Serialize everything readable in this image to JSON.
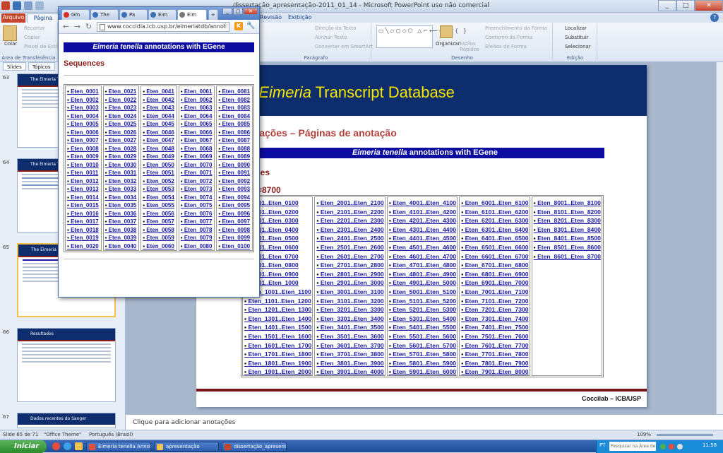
{
  "ppt": {
    "title": "dissertação_apresentação-2011_01_14  -  Microsoft PowerPoint uso não comercial",
    "tabs": {
      "file": "Arquivo",
      "home": "Página Inicial",
      "review": "Revisão",
      "view": "Exibição"
    },
    "ribbon": {
      "clipboard": {
        "paste": "Colar",
        "cut": "Recortar",
        "copy": "Copiar",
        "format_painter": "Pincel de Estilo",
        "label": "Área de Transferência"
      },
      "paragraph": {
        "text_direction": "Direção do Texto",
        "align_text": "Alinhar Texto",
        "smartart": "Converter em SmartArt",
        "label": "Parágrafo"
      },
      "drawing": {
        "arrange": "Organizar",
        "quick_styles": "Estilos Rápidos",
        "fill": "Preenchimento da Forma",
        "outline": "Contorno da Forma",
        "effects": "Efeitos de Forma",
        "label": "Desenho"
      },
      "editing": {
        "find": "Localizar",
        "replace": "Substituir",
        "select": "Selecionar",
        "label": "Edição"
      }
    },
    "panel_tabs": {
      "slides": "Slides",
      "outline": "Tópicos"
    },
    "thumbs": [
      {
        "num": "63",
        "title": "The Eimeria Transcript"
      },
      {
        "num": "64",
        "title": "The Eimeria Transcript"
      },
      {
        "num": "65",
        "title": "The Eimeria Transcript"
      },
      {
        "num": "66",
        "title": "Resultados"
      },
      {
        "num": "67",
        "title": "Dados recentes do Sanger"
      }
    ],
    "slide": {
      "title_prefix": "e ",
      "title_italic": "Eimeria",
      "title_rest": " Transcript Database",
      "subtitle": "ntações – Páginas de anotação",
      "banner_italic": "Eimeria tenella",
      "banner_rest": " annotations with EGene",
      "sequences": "ences",
      "count": "NT=8700",
      "footer": "Coccilab – ICB/USP",
      "columns": [
        [
          "_0001..Eten_0100",
          "_0101..Eten_0200",
          "_0201..Eten_0300",
          "_0301..Eten_0400",
          "_0401..Eten_0500",
          "_0501..Eten_0600",
          "_0601..Eten_0700",
          "_0701..Eten_0800",
          "_0801..Eten_0900",
          "_0901..Eten_1000",
          "Eten_1001..Eten_1100",
          "Eten_1101..Eten_1200",
          "Eten_1201..Eten_1300",
          "Eten_1301..Eten_1400",
          "Eten_1401..Eten_1500",
          "Eten_1501..Eten_1600",
          "Eten_1601..Eten_1700",
          "Eten_1701..Eten_1800",
          "Eten_1801..Eten_1900",
          "Eten_1901..Eten_2000"
        ],
        [
          "Eten_2001..Eten_2100",
          "Eten_2101..Eten_2200",
          "Eten_2201..Eten_2300",
          "Eten_2301..Eten_2400",
          "Eten_2401..Eten_2500",
          "Eten_2501..Eten_2600",
          "Eten_2601..Eten_2700",
          "Eten_2701..Eten_2800",
          "Eten_2801..Eten_2900",
          "Eten_2901..Eten_3000",
          "Eten_3001..Eten_3100",
          "Eten_3101..Eten_3200",
          "Eten_3201..Eten_3300",
          "Eten_3301..Eten_3400",
          "Eten_3401..Eten_3500",
          "Eten_3501..Eten_3600",
          "Eten_3601..Eten_3700",
          "Eten_3701..Eten_3800",
          "Eten_3801..Eten_3900",
          "Eten_3901..Eten_4000"
        ],
        [
          "Eten_4001..Eten_4100",
          "Eten_4101..Eten_4200",
          "Eten_4201..Eten_4300",
          "Eten_4301..Eten_4400",
          "Eten_4401..Eten_4500",
          "Eten_4501..Eten_4600",
          "Eten_4601..Eten_4700",
          "Eten_4701..Eten_4800",
          "Eten_4801..Eten_4900",
          "Eten_4901..Eten_5000",
          "Eten_5001..Eten_5100",
          "Eten_5101..Eten_5200",
          "Eten_5201..Eten_5300",
          "Eten_5301..Eten_5400",
          "Eten_5401..Eten_5500",
          "Eten_5501..Eten_5600",
          "Eten_5601..Eten_5700",
          "Eten_5701..Eten_5800",
          "Eten_5801..Eten_5900",
          "Eten_5901..Eten_6000"
        ],
        [
          "Eten_6001..Eten_6100",
          "Eten_6101..Eten_6200",
          "Eten_6201..Eten_6300",
          "Eten_6301..Eten_6400",
          "Eten_6401..Eten_6500",
          "Eten_6501..Eten_6600",
          "Eten_6601..Eten_6700",
          "Eten_6701..Eten_6800",
          "Eten_6801..Eten_6900",
          "Eten_6901..Eten_7000",
          "Eten_7001..Eten_7100",
          "Eten_7101..Eten_7200",
          "Eten_7201..Eten_7300",
          "Eten_7301..Eten_7400",
          "Eten_7401..Eten_7500",
          "Eten_7501..Eten_7600",
          "Eten_7601..Eten_7700",
          "Eten_7701..Eten_7800",
          "Eten_7801..Eten_7900",
          "Eten_7901..Eten_8000"
        ],
        [
          "Eten_8001..Eten_8100",
          "Eten_8101..Eten_8200",
          "Eten_8201..Eten_8300",
          "Eten_8301..Eten_8400",
          "Eten_8401..Eten_8500",
          "Eten_8501..Eten_8600",
          "Eten_8601..Eten_8700"
        ]
      ]
    },
    "notes_placeholder": "Clique para adicionar anotações",
    "status": {
      "slide": "Slide 65 de 71",
      "theme": "\"Office Theme\"",
      "language": "Português (Brasil)",
      "zoom": "109%"
    }
  },
  "browser": {
    "tabs": [
      "Gm",
      "The",
      "Pa",
      "Eim",
      "Eim"
    ],
    "url": "www.coccidia.icb.usp.br/eimeriatdb/annot",
    "banner_italic": "Eimeria tenella",
    "banner_rest": " annotations with EGene",
    "sequences": "Sequences",
    "columns": [
      [
        "Eten_0001",
        "Eten_0002",
        "Eten_0003",
        "Eten_0004",
        "Eten_0005",
        "Eten_0006",
        "Eten_0007",
        "Eten_0008",
        "Eten_0009",
        "Eten_0010",
        "Eten_0011",
        "Eten_0012",
        "Eten_0013",
        "Eten_0014",
        "Eten_0015",
        "Eten_0016",
        "Eten_0017",
        "Eten_0018",
        "Eten_0019",
        "Eten_0020"
      ],
      [
        "Eten_0021",
        "Eten_0022",
        "Eten_0023",
        "Eten_0024",
        "Eten_0025",
        "Eten_0026",
        "Eten_0027",
        "Eten_0028",
        "Eten_0029",
        "Eten_0030",
        "Eten_0031",
        "Eten_0032",
        "Eten_0033",
        "Eten_0034",
        "Eten_0035",
        "Eten_0036",
        "Eten_0037",
        "Eten_0038",
        "Eten_0039",
        "Eten_0040"
      ],
      [
        "Eten_0041",
        "Eten_0042",
        "Eten_0043",
        "Eten_0044",
        "Eten_0045",
        "Eten_0046",
        "Eten_0047",
        "Eten_0048",
        "Eten_0049",
        "Eten_0050",
        "Eten_0051",
        "Eten_0052",
        "Eten_0053",
        "Eten_0054",
        "Eten_0055",
        "Eten_0056",
        "Eten_0057",
        "Eten_0058",
        "Eten_0059",
        "Eten_0060"
      ],
      [
        "Eten_0061",
        "Eten_0062",
        "Eten_0063",
        "Eten_0064",
        "Eten_0065",
        "Eten_0066",
        "Eten_0067",
        "Eten_0068",
        "Eten_0069",
        "Eten_0070",
        "Eten_0071",
        "Eten_0072",
        "Eten_0073",
        "Eten_0074",
        "Eten_0075",
        "Eten_0076",
        "Eten_0077",
        "Eten_0078",
        "Eten_0079",
        "Eten_0080"
      ],
      [
        "Eten_0081",
        "Eten_0082",
        "Eten_0083",
        "Eten_0084",
        "Eten_0085",
        "Eten_0086",
        "Eten_0087",
        "Eten_0088",
        "Eten_0089",
        "Eten_0090",
        "Eten_0091",
        "Eten_0092",
        "Eten_0093",
        "Eten_0094",
        "Eten_0095",
        "Eten_0096",
        "Eten_0097",
        "Eten_0098",
        "Eten_0099",
        "Eten_0100"
      ]
    ]
  },
  "taskbar": {
    "start": "Iniciar",
    "buttons": [
      "Eimeria tenella Annot...",
      "apresentação",
      "dissertação_apresent..."
    ],
    "lang": "PT",
    "search_placeholder": "Pesquisar na Área de",
    "clock": "11:58"
  }
}
